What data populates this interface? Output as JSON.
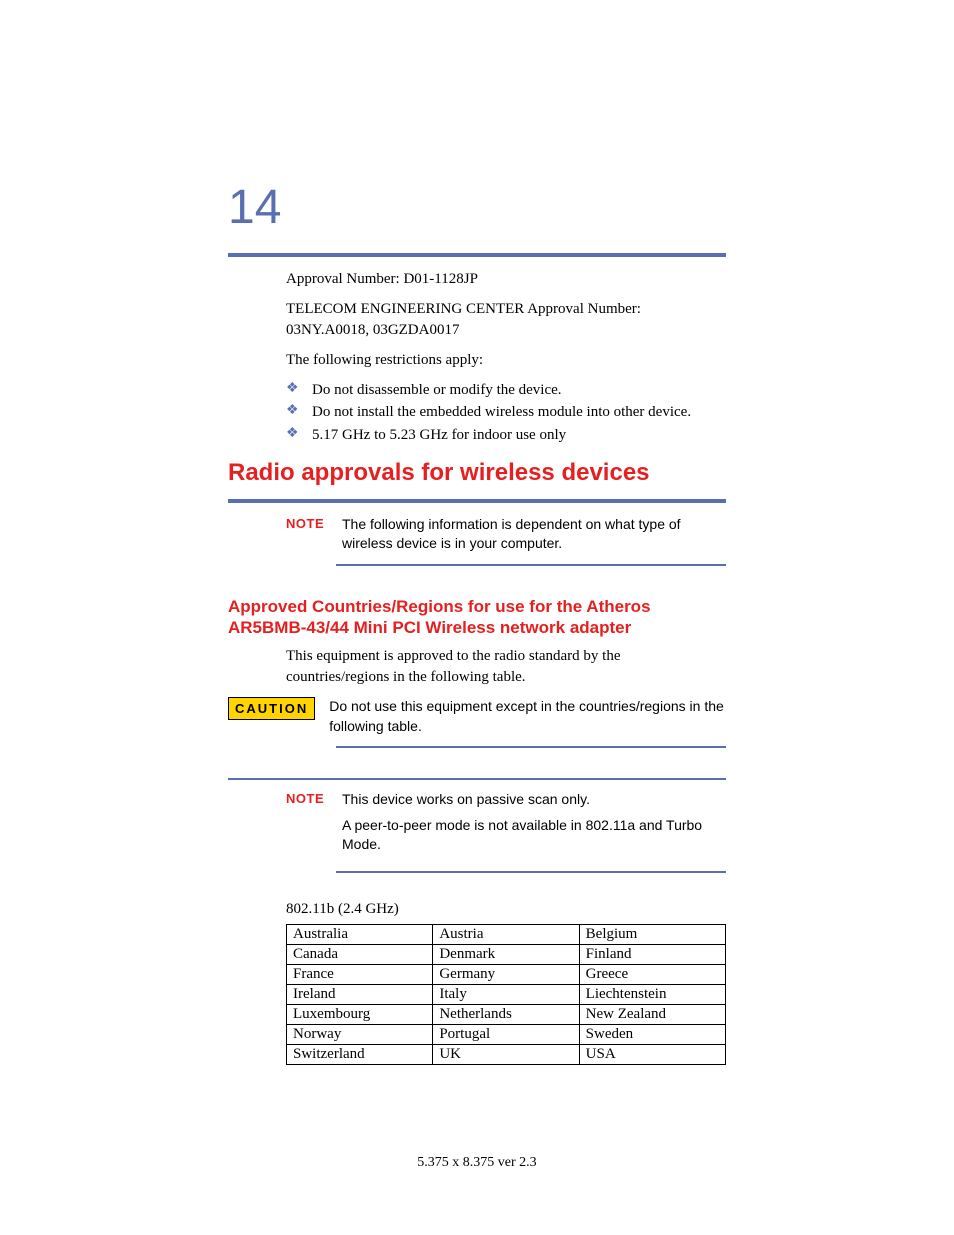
{
  "page_number": "14",
  "intro": {
    "approval1": "Approval Number: D01-1128JP",
    "approval2": "TELECOM ENGINEERING CENTER Approval Number: 03NY.A0018, 03GZDA0017",
    "restrictions_intro": "The following restrictions apply:",
    "restrictions": [
      "Do not disassemble or modify the device.",
      "Do not install the embedded wireless module into other device.",
      "5.17 GHz to 5.23 GHz for indoor use only"
    ]
  },
  "heading_main": "Radio approvals for wireless devices",
  "note1": {
    "label": "NOTE",
    "text": "The following information is dependent on what type of wireless device is in your computer."
  },
  "heading_sub": "Approved Countries/Regions for use for the Atheros AR5BMB-43/44 Mini PCI Wireless network adapter",
  "sub_body": "This equipment is approved to the radio standard by the countries/regions in the following table.",
  "caution": {
    "label": "CAUTION",
    "text": "Do not use this equipment except in the countries/regions in the following table."
  },
  "note2": {
    "label": "NOTE",
    "line1": "This device works on passive scan only.",
    "line2": "A peer-to-peer mode is not available in 802.11a and Turbo Mode."
  },
  "table": {
    "title": "802.11b (2.4 GHz)",
    "rows": [
      [
        "Australia",
        "Austria",
        "Belgium"
      ],
      [
        "Canada",
        "Denmark",
        "Finland"
      ],
      [
        "France",
        "Germany",
        "Greece"
      ],
      [
        "Ireland",
        "Italy",
        "Liechtenstein"
      ],
      [
        "Luxembourg",
        "Netherlands",
        "New Zealand"
      ],
      [
        "Norway",
        "Portugal",
        "Sweden"
      ],
      [
        "Switzerland",
        "UK",
        "USA"
      ]
    ]
  },
  "footer": "5.375 x 8.375 ver 2.3"
}
